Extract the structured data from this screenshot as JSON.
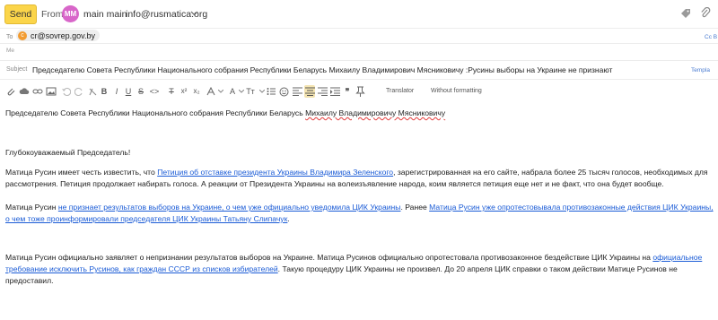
{
  "header": {
    "send_label": "Send",
    "from_label": "From:",
    "from_initials": "MM",
    "from_name": "main main",
    "from_email": "info@rusmatica.org"
  },
  "to": {
    "label": "To",
    "chip_initial": "c",
    "chip_email": "cr@sovrep.gov.by",
    "cc_label": "Cc B"
  },
  "me_label": "Me",
  "subject": {
    "label": "Subject",
    "text": "Председателю Совета Республики Национального собрания Республики Беларусь Михаилу Владимирович Мясниковичу  :Русины выборы на Украине не признают",
    "template_label": "Templa"
  },
  "toolbar": {
    "translator_label": "Translator",
    "without_formatting_label": "Without formatting"
  },
  "body": {
    "p1_a": "Председателю Совета Республики Национального собрания Республики Беларусь ",
    "p1_b": "Михаилу Владимировичу Мясниковичу",
    "p2": "Глубокоуважаемый Председатель!",
    "p3_a": "Матица Русин имеет честь известить, что ",
    "p3_link": "Петиция об отставке президента Украины Владимира Зеленского",
    "p3_b": ", зарегистрированная на его сайте, набрала более 25 тысяч голосов, необходимых для рассмотрения. Петиция продолжает набирать голоса. А реакции от Президента Украины на волеизъявление народа, коим является петиция еще нет и не факт, что она будет вообще.",
    "p4_a": "Матица Русин ",
    "p4_link1": "не признает результатов выборов на Украине, о чем уже официально уведомила ЦИК Украины",
    "p4_b": ". Ранее ",
    "p4_link2": "Матица Русин уже опротестовывала противозаконные действия ЦИК Украины, о чем тоже проинформировали председателя ЦИК Украины Татьяну Слипачук",
    "p4_c": ".",
    "p5_a": "Матица Русин официально заявляет о непризнании результатов выборов на Украине. Матица Русинов официально опротестовала противозаконное бездействие ЦИК Украины на ",
    "p5_link": "официальное требование исключить Русинов, как граждан СССР из списков избирателей",
    "p5_b": ". Такую процедуру ЦИК Украины не произвел. До 20 апреля ЦИК справки о таком действии Матице Русинов не предоставил."
  },
  "colors": {
    "send_button": "#fbd54a",
    "from_avatar": "#d866c9",
    "to_avatar": "#f29b30",
    "link": "#1a5bd6",
    "spell_underline": "#e23a3a"
  }
}
